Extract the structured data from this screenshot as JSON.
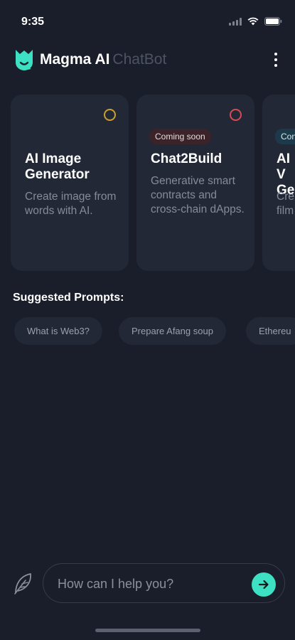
{
  "status_bar": {
    "time": "9:35"
  },
  "header": {
    "title": "Magma AI",
    "subtitle": "ChatBot"
  },
  "cards": [
    {
      "title": "AI Image Generator",
      "description": "Create image from words with AI.",
      "badge": "",
      "ring_color": "#c9a030"
    },
    {
      "title": "Chat2Build",
      "description": "Generative smart contracts and cross-chain dApps.",
      "badge": "Coming soon",
      "ring_color": "#d94a52"
    },
    {
      "title": "AI V Ge",
      "description": "Cre film",
      "badge": "Con",
      "ring_color": ""
    }
  ],
  "suggested": {
    "title": "Suggested Prompts:",
    "chips": [
      "What is Web3?",
      "Prepare Afang soup",
      "Ethereu"
    ]
  },
  "composer": {
    "placeholder": "How can I help you?"
  },
  "colors": {
    "accent": "#3ee0c3",
    "background": "#1a1e2a",
    "card": "#222836"
  }
}
